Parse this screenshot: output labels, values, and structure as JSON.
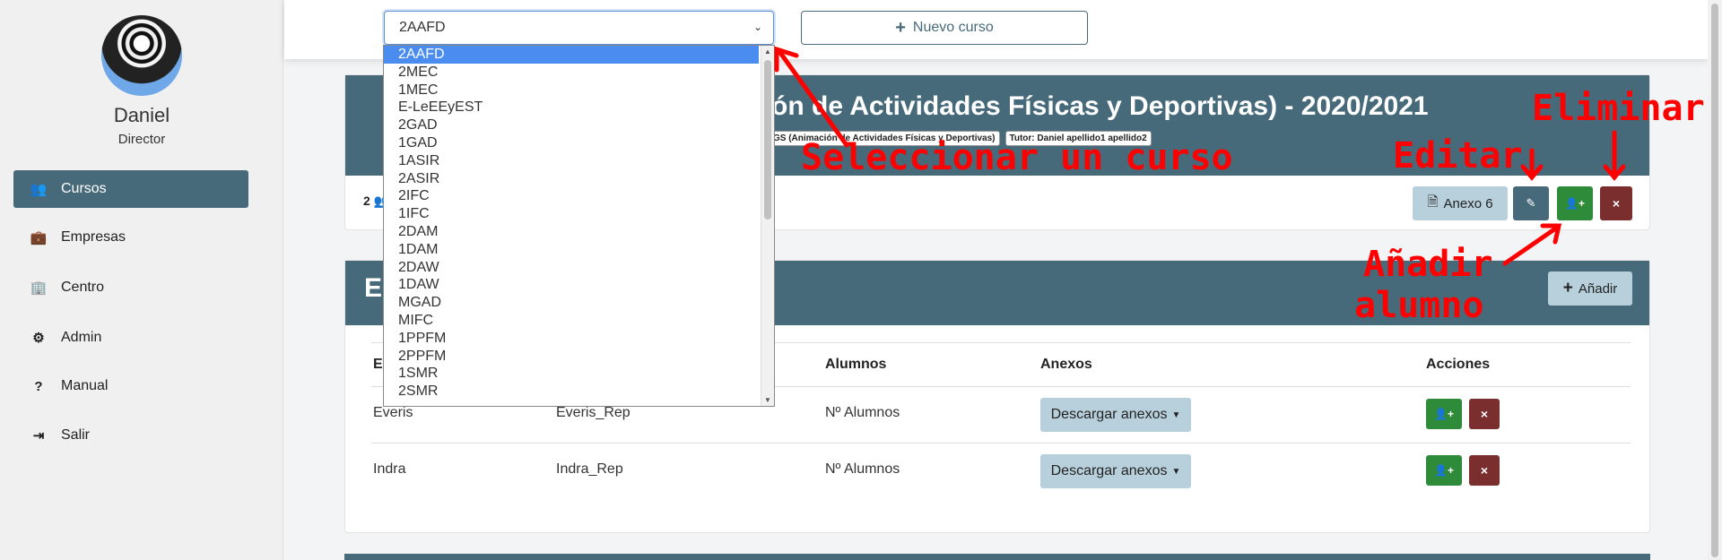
{
  "user": {
    "name": "Daniel",
    "role": "Director"
  },
  "sidebar": {
    "items": [
      {
        "label": "Cursos",
        "icon": "users-icon",
        "glyph": "👥"
      },
      {
        "label": "Empresas",
        "icon": "briefcase-icon",
        "glyph": "💼"
      },
      {
        "label": "Centro",
        "icon": "building-icon",
        "glyph": "🏢"
      },
      {
        "label": "Admin",
        "icon": "cogs-icon",
        "glyph": "⚙"
      },
      {
        "label": "Manual",
        "icon": "question-icon",
        "glyph": "?"
      },
      {
        "label": "Salir",
        "icon": "sign-out-icon",
        "glyph": "⇥"
      }
    ]
  },
  "topbar": {
    "selected_course": "2AAFD",
    "new_course_label": "Nuevo curso"
  },
  "course_select": {
    "options": [
      "2AAFD",
      "2MEC",
      "1MEC",
      "E-LeEEyEST",
      "2GAD",
      "1GAD",
      "1ASIR",
      "2ASIR",
      "2IFC",
      "1IFC",
      "2DAM",
      "1DAM",
      "2DAW",
      "1DAW",
      "MGAD",
      "MIFC",
      "1PPFM",
      "2PPFM",
      "1SMR",
      "2SMR"
    ]
  },
  "course_card": {
    "title": "ción de Actividades Físicas y Deportivas) - 2020/2021",
    "badge_type": "a: CFGS (Animación de Actividades Físicas y Deportivas)",
    "badge_tutor": "Tutor: Daniel apellido1 apellido2",
    "student_count": "2",
    "anexo_label": "Anexo 6"
  },
  "companies": {
    "section_letter": "E",
    "add_label": "Añadir",
    "headers": {
      "company": "E",
      "students": "Alumnos",
      "anexos": "Anexos",
      "actions": "Acciones"
    },
    "rows": [
      {
        "name": "Everis",
        "rep": "Everis_Rep",
        "students": "Nº Alumnos",
        "download": "Descargar anexos"
      },
      {
        "name": "Indra",
        "rep": "Indra_Rep",
        "students": "Nº Alumnos",
        "download": "Descargar anexos"
      }
    ]
  },
  "annotations": {
    "select_course": "Seleccionar un curso",
    "edit": "Editar",
    "delete": "Eliminar",
    "add_student_1": "Añadir",
    "add_student_2": "alumno"
  },
  "colors": {
    "primary": "#476a7b",
    "light": "#b7d0dc",
    "success": "#2e8b3a",
    "danger": "#7a2e2e",
    "annotation": "#ff0000",
    "option_selected": "#4a8cf0"
  }
}
